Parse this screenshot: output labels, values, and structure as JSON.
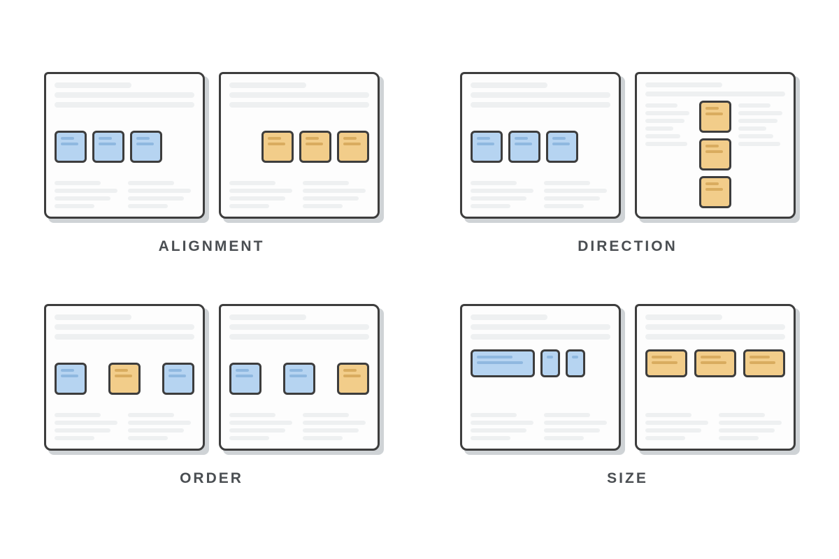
{
  "concepts": {
    "alignment": {
      "label": "ALIGNMENT"
    },
    "direction": {
      "label": "DIRECTION"
    },
    "order": {
      "label": "ORDER"
    },
    "size": {
      "label": "SIZE"
    }
  },
  "colors": {
    "blue": "#b6d4f1",
    "orange": "#f2cd8a",
    "border": "#3d3d3d",
    "placeholder": "#eef0f1"
  }
}
